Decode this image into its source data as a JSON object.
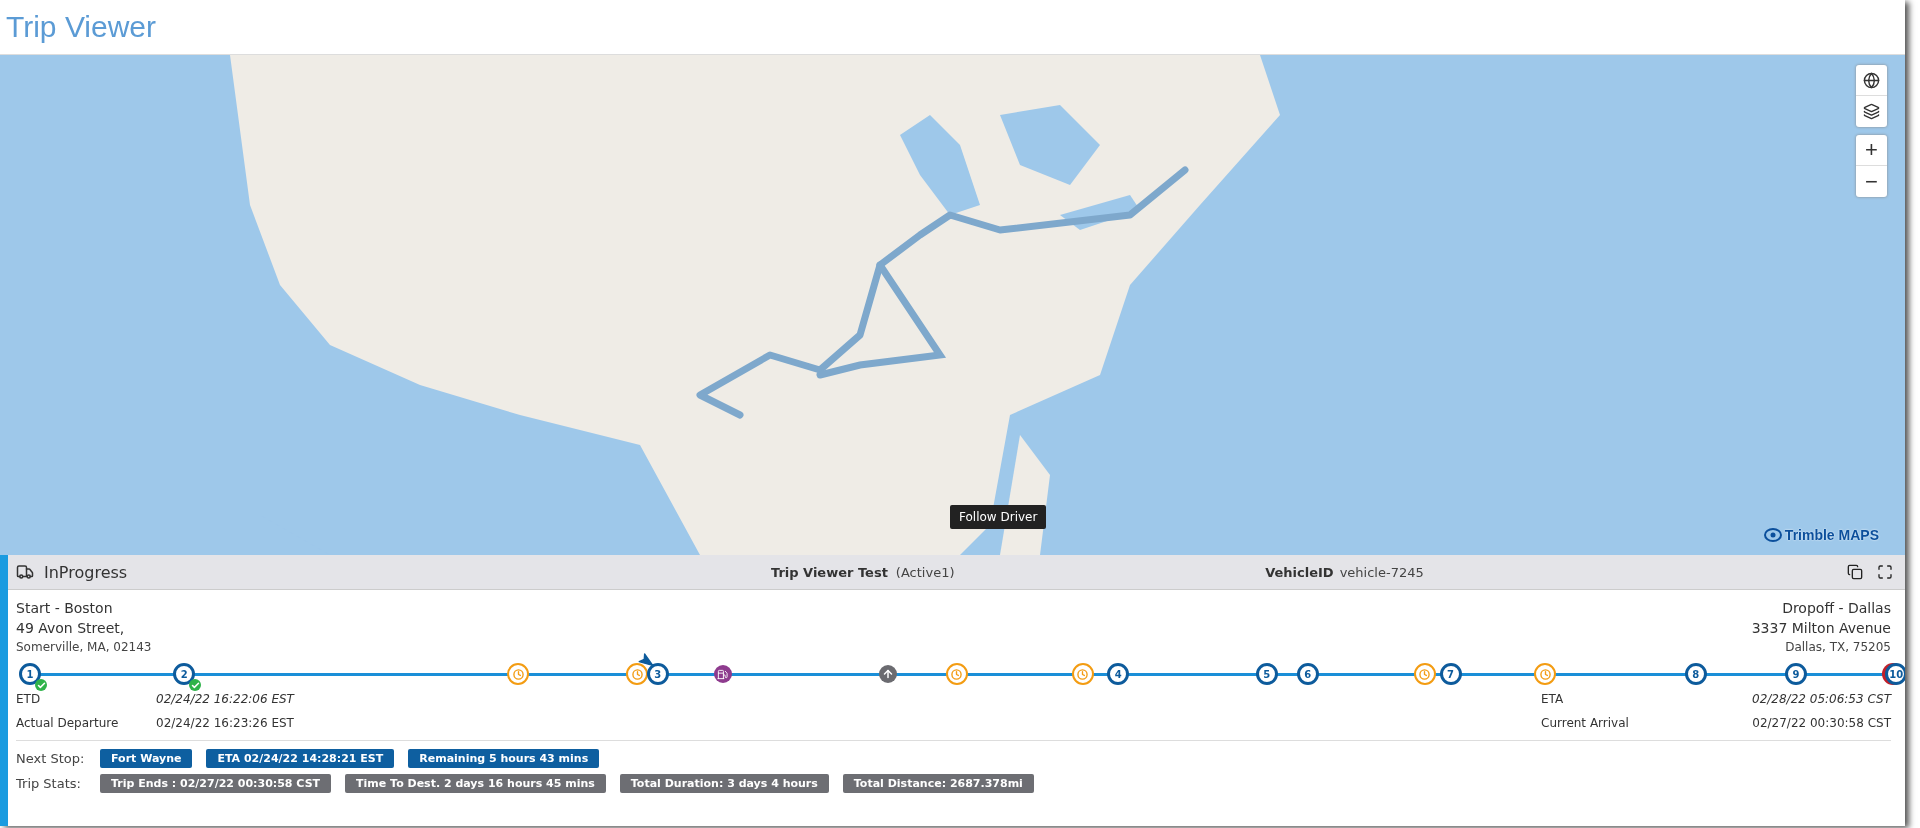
{
  "page_title": "Trip Viewer",
  "map": {
    "controls": [
      {
        "kind": "globe"
      },
      {
        "kind": "layers"
      },
      {
        "kind": "text",
        "label": "+"
      },
      {
        "kind": "text",
        "label": "−"
      }
    ],
    "tooltip": "Follow Driver",
    "attribution": "Trimble MAPS"
  },
  "trip": {
    "status": "InProgress",
    "name": "Trip Viewer Test",
    "state": "(Active1)",
    "vehicle_label": "VehicleID",
    "vehicle_id": "vehicle-7245"
  },
  "start": {
    "title": "Start - Boston",
    "street": "49 Avon Street,",
    "city": "Somerville, MA, 02143"
  },
  "dropoff": {
    "title": "Dropoff - Dallas",
    "street": "3337 Milton Avenue",
    "city": "Dallas, TX, 75205"
  },
  "timeline": [
    {
      "kind": "stop",
      "label": "1",
      "completed": true,
      "alert": false
    },
    {
      "kind": "stop",
      "label": "2",
      "completed": true,
      "alert": false
    },
    {
      "kind": "break"
    },
    {
      "kind": "break"
    },
    {
      "kind": "vehicle"
    },
    {
      "kind": "stop",
      "label": "3",
      "completed": false,
      "alert": false
    },
    {
      "kind": "fuel"
    },
    {
      "kind": "waypoint"
    },
    {
      "kind": "break"
    },
    {
      "kind": "break"
    },
    {
      "kind": "stop",
      "label": "4",
      "completed": false,
      "alert": false
    },
    {
      "kind": "stop",
      "label": "5",
      "completed": false,
      "alert": false
    },
    {
      "kind": "stop",
      "label": "6",
      "completed": false,
      "alert": false
    },
    {
      "kind": "break"
    },
    {
      "kind": "stop",
      "label": "7",
      "completed": false,
      "alert": false
    },
    {
      "kind": "break"
    },
    {
      "kind": "stop",
      "label": "8",
      "completed": false,
      "alert": false
    },
    {
      "kind": "stop",
      "label": "9",
      "completed": false,
      "alert": false
    },
    {
      "kind": "stop",
      "label": "10",
      "completed": false,
      "alert": true
    }
  ],
  "left_times": [
    {
      "label": "ETD",
      "value": "02/24/22 16:22:06 EST",
      "italic": true
    },
    {
      "label": "Actual Departure",
      "value": "02/24/22 16:23:26 EST",
      "italic": false
    }
  ],
  "right_times": [
    {
      "label": "ETA",
      "value": "02/28/22 05:06:53 CST",
      "italic": true
    },
    {
      "label": "Current Arrival",
      "value": "02/27/22 00:30:58 CST",
      "italic": false
    }
  ],
  "next_stop": {
    "label": "Next Stop:",
    "badges": [
      "Fort Wayne",
      "ETA 02/24/22 14:28:21 EST",
      "Remaining 5 hours 43 mins"
    ]
  },
  "trip_stats": {
    "label": "Trip Stats:",
    "badges": [
      "Trip Ends : 02/27/22 00:30:58 CST",
      "Time To Dest. 2 days 16 hours 45 mins",
      "Total Duration: 3 days 4 hours",
      "Total Distance: 2687.378mi"
    ]
  }
}
